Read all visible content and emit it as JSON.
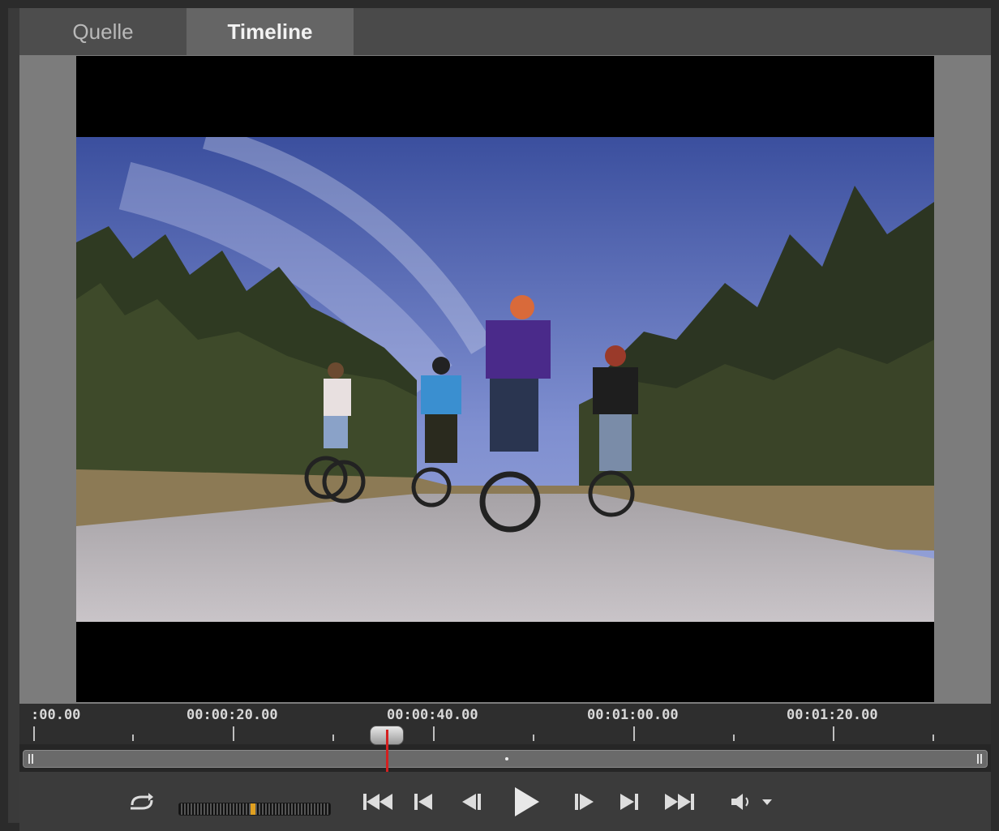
{
  "tabs": [
    {
      "label": "Quelle",
      "active": false
    },
    {
      "label": "Timeline",
      "active": true
    }
  ],
  "timeline": {
    "tick_labels": [
      ":00.00",
      "00:00:20.00",
      "00:00:40.00",
      "00:01:00.00",
      "00:01:20.00"
    ],
    "playhead_color": "#d42020",
    "playhead_time_seconds": 35
  },
  "controls": {
    "icons": [
      "loop-icon",
      "shuttle-slider",
      "go-to-start-icon",
      "previous-edit-icon",
      "step-back-icon",
      "play-icon",
      "step-forward-icon",
      "next-edit-icon",
      "go-to-end-icon",
      "volume-icon",
      "chevron-down-icon"
    ]
  },
  "colors": {
    "background": "#2b2b2b",
    "tab_active": "#656565",
    "monitor_bg": "#7c7c7c"
  }
}
